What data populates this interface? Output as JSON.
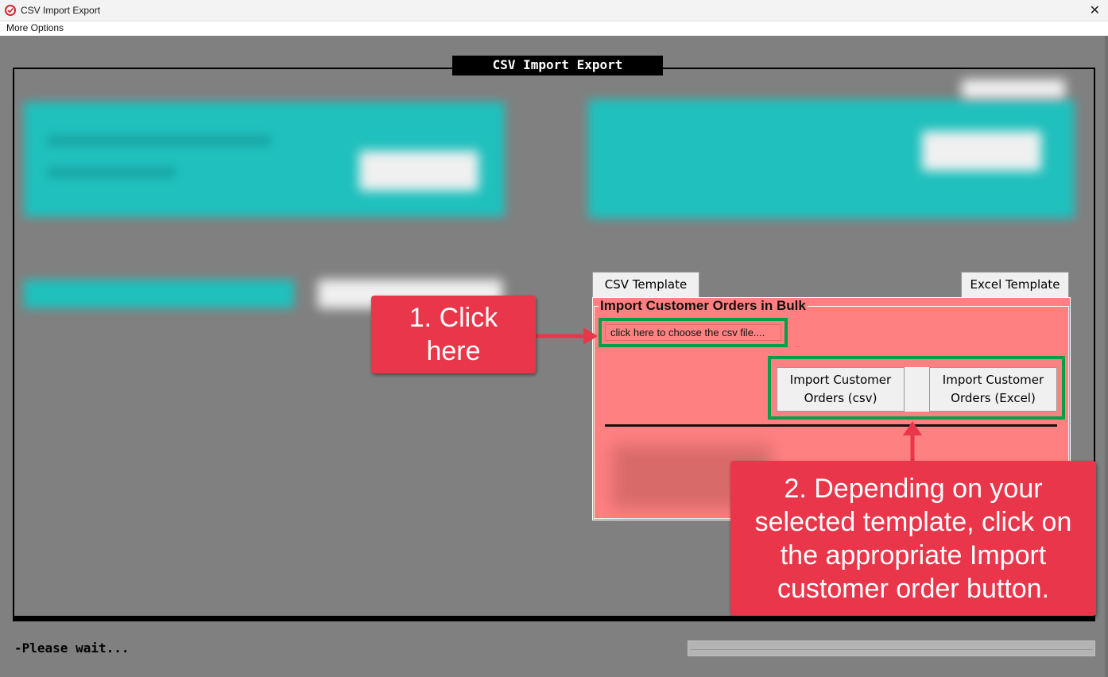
{
  "window": {
    "title": "CSV Import Export",
    "close_glyph": "✕"
  },
  "menu": {
    "more_options": "More Options"
  },
  "frame": {
    "title": "CSV Import Export"
  },
  "templates": {
    "csv_label": "CSV Template",
    "excel_label": "Excel Template"
  },
  "import_panel": {
    "legend": "Import Customer Orders in Bulk",
    "choose_file_placeholder": "click here to choose the csv file....",
    "import_csv_line1": "Import Customer",
    "import_csv_line2": "Orders (csv)",
    "import_excel_line1": "Import Customer",
    "import_excel_line2": "Orders (Excel)"
  },
  "annotations": {
    "step1_line1": "1. Click",
    "step1_line2": "here",
    "step2_line1": "2. Depending on your",
    "step2_line2": "selected template, click on",
    "step2_line3": "the appropriate Import",
    "step2_line4": "customer order button."
  },
  "status": {
    "message": "-Please wait...",
    "progress_fraction": 1.0
  },
  "colors": {
    "panel_bg": "#ff8080",
    "highlight_green": "#00a04a",
    "callout_red": "#e9364a",
    "teal": "#1fc0bd"
  }
}
